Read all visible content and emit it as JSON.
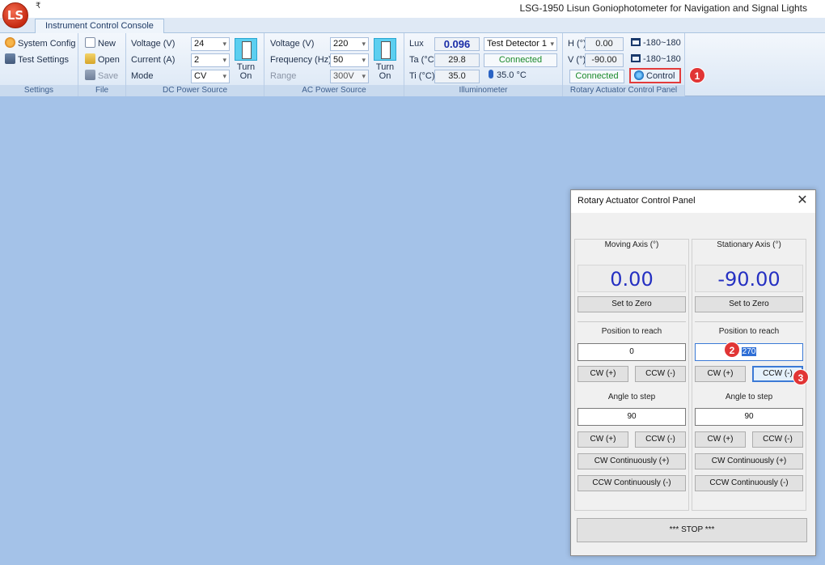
{
  "window": {
    "title": "LSG-1950 Lisun Goniophotometer for Navigation and Signal Lights",
    "logo_text": "LS",
    "qat_glyph": "₹"
  },
  "tabs": [
    {
      "label": "Instrument Control Console"
    }
  ],
  "ribbon": {
    "settings": {
      "label": "Settings",
      "system_config": "System Config",
      "test_settings": "Test Settings"
    },
    "file": {
      "label": "File",
      "new": "New",
      "open": "Open",
      "save": "Save"
    },
    "dc": {
      "label": "DC Power Source",
      "voltage_label": "Voltage (V)",
      "voltage_value": "24",
      "current_label": "Current (A)",
      "current_value": "2",
      "mode_label": "Mode",
      "mode_value": "CV",
      "turn_on_line1": "Turn",
      "turn_on_line2": "On"
    },
    "ac": {
      "label": "AC Power Source",
      "voltage_label": "Voltage (V)",
      "voltage_value": "220",
      "frequency_label": "Frequency (Hz)",
      "frequency_value": "50",
      "range_label": "Range",
      "range_value": "300V",
      "turn_on_line1": "Turn",
      "turn_on_line2": "On"
    },
    "illuminometer": {
      "label": "Illuminometer",
      "lux_label": "Lux",
      "lux_value": "0.096",
      "ta_label": "Ta (°C)",
      "ta_value": "29.8",
      "ti_label": "Ti (°C)",
      "ti_value": "35.0",
      "detector_value": "Test Detector 1",
      "status": "Connected",
      "temp_reading": "35.0 °C"
    },
    "rotary": {
      "label": "Rotary Actuator Control Panel",
      "h_label": "H (°)",
      "h_value": "0.00",
      "v_label": "V (°)",
      "v_value": "-90.00",
      "h_range": "-180~180",
      "v_range": "-180~180",
      "status": "Connected",
      "control": "Control"
    }
  },
  "badges": [
    "1",
    "2",
    "3"
  ],
  "dialog": {
    "title": "Rotary Actuator Control Panel",
    "close": "✕",
    "moving": {
      "title": "Moving Axis (°)",
      "reading": "0.00",
      "set_zero": "Set to Zero",
      "position_label": "Position to reach",
      "position_value": "0",
      "cw": "CW  (+)",
      "ccw": "CCW (-)",
      "step_label": "Angle to step",
      "step_value": "90",
      "step_cw": "CW  (+)",
      "step_ccw": "CCW (-)",
      "cw_cont": "CW Continuously (+)",
      "ccw_cont": "CCW Continuously (-)"
    },
    "stationary": {
      "title": "Stationary Axis (°)",
      "reading": "-90.00",
      "set_zero": "Set to Zero",
      "position_label": "Position to reach",
      "position_value": "270",
      "cw": "CW  (+)",
      "ccw": "CCW (-)",
      "step_label": "Angle to step",
      "step_value": "90",
      "step_cw": "CW  (+)",
      "step_ccw": "CCW (-)",
      "cw_cont": "CW Continuously (+)",
      "ccw_cont": "CCW Continuously (-)"
    },
    "stop": "*** STOP ***"
  }
}
